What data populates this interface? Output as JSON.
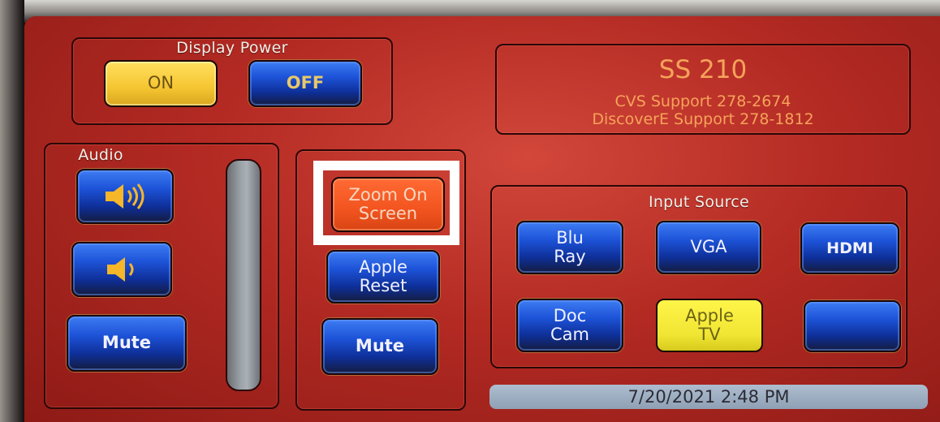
{
  "display_power": {
    "title": "Display Power",
    "on_label": "ON",
    "off_label": "OFF"
  },
  "room_info": {
    "room": "SS 210",
    "line1": "CVS Support 278-2674",
    "line2": "DiscoverE Support 278-1812"
  },
  "audio": {
    "title": "Audio",
    "volume_up_icon": "speaker-loud-icon",
    "volume_down_icon": "speaker-quiet-icon",
    "mute_label": "Mute"
  },
  "zoom_panel": {
    "zoom_label_line1": "Zoom On",
    "zoom_label_line2": "Screen",
    "apple_reset_line1": "Apple",
    "apple_reset_line2": "Reset",
    "mute_label": "Mute"
  },
  "input_source": {
    "title": "Input Source",
    "sources": [
      {
        "line1": "Blu",
        "line2": "Ray"
      },
      {
        "line1": "VGA",
        "line2": ""
      },
      {
        "line1": "HDMI",
        "line2": ""
      },
      {
        "line1": "Doc",
        "line2": "Cam"
      },
      {
        "line1": "Apple",
        "line2": "TV"
      },
      {
        "line1": "",
        "line2": ""
      }
    ],
    "selected_index": 4
  },
  "status": {
    "datetime": "7/20/2021 2:48 PM"
  },
  "colors": {
    "screen_red": "#b32a23",
    "button_blue": "#1d53d8",
    "on_yellow": "#f5c531",
    "selected_yellow": "#f0e532",
    "zoom_orange": "#f2541f",
    "info_text": "#f6a35a"
  }
}
